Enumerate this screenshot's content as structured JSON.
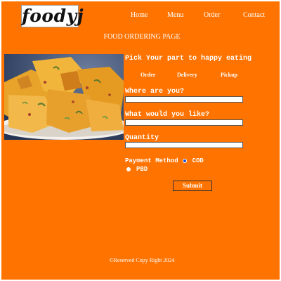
{
  "brand": {
    "logo_text": "foodyj"
  },
  "nav": {
    "items": [
      "Home",
      "Menu",
      "Order",
      "Contact"
    ]
  },
  "page_title": "FOOD ORDERING PAGE",
  "form": {
    "tagline": "Pick Your part to happy eating",
    "options": [
      "Order",
      "Delivery",
      "Pickup"
    ],
    "location_label": "Where are you?",
    "location_value": "",
    "item_label": "What would you like?",
    "item_value": "",
    "quantity_label": "Quantity",
    "quantity_value": "",
    "payment_label": "Payment Method",
    "payment_options": [
      "COD",
      "PBD"
    ],
    "payment_selected": "COD",
    "submit_label": "Submit"
  },
  "footer": {
    "text": "©Reserved Copy Right 2024"
  },
  "colors": {
    "background": "#ff7300",
    "text": "#ffffff",
    "radio_selected": "#1a4fd6"
  }
}
